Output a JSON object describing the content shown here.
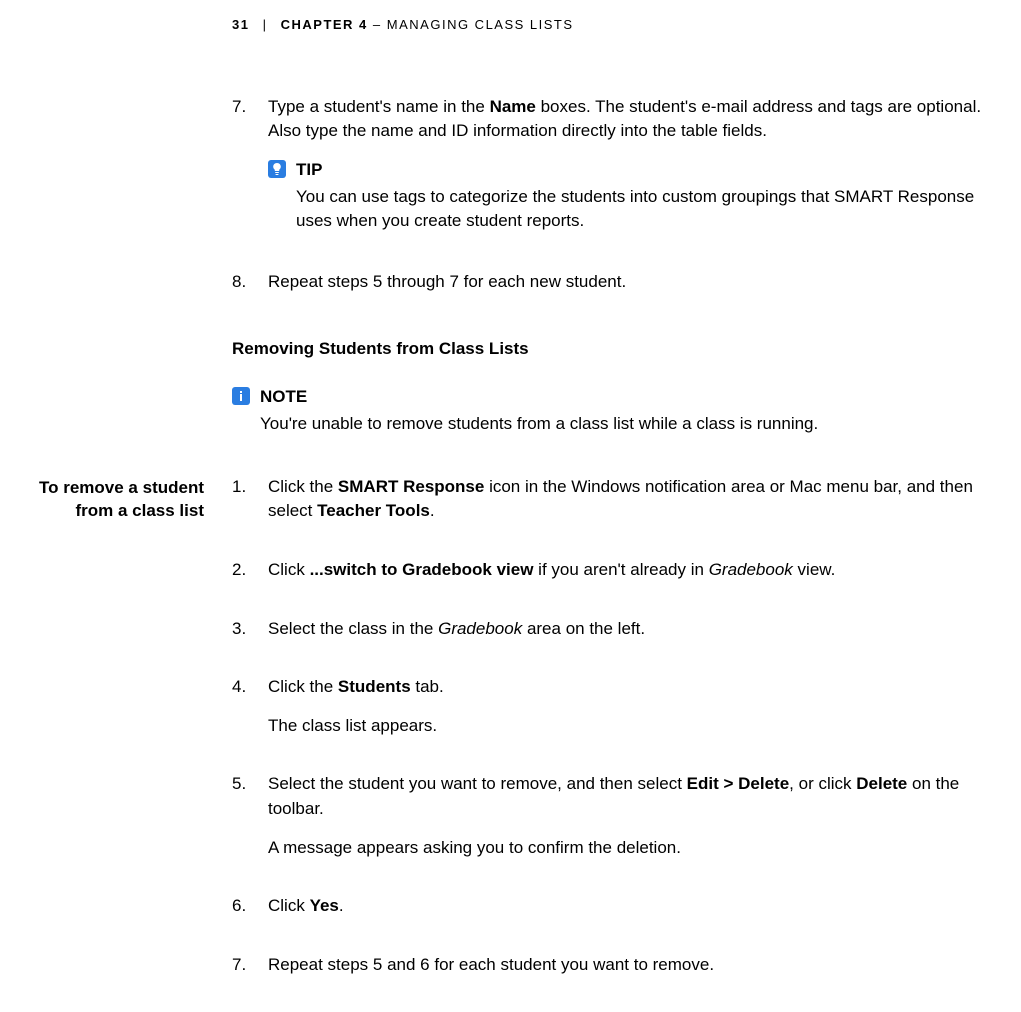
{
  "header": {
    "page": "31",
    "separator": "|",
    "chapter": "CHAPTER 4",
    "dash": "–",
    "title": "MANAGING CLASS LISTS"
  },
  "initialSteps": {
    "step7": {
      "num": "7.",
      "p1_a": "Type a student's name in the ",
      "p1_b": "Name",
      "p1_c": " boxes. The student's e-mail address and tags are optional. Also type the name and ID information directly into the table fields."
    },
    "tip": {
      "title": "TIP",
      "body": "You can use tags to categorize the students into custom groupings that SMART Response uses when you create student reports."
    },
    "step8": {
      "num": "8.",
      "p1": "Repeat steps 5 through 7 for each new student."
    }
  },
  "section": {
    "heading": "Removing Students from Class Lists",
    "note": {
      "title": "NOTE",
      "body": "You're unable to remove students from a class list while a class is running."
    }
  },
  "sidenote": {
    "line1": "To remove a student",
    "line2": "from a class list"
  },
  "removeSteps": {
    "s1": {
      "num": "1.",
      "a": "Click the ",
      "b": "SMART Response",
      "c": " icon in the Windows notification area or Mac menu bar, and then select ",
      "d": "Teacher Tools",
      "e": "."
    },
    "s2": {
      "num": "2.",
      "a": "Click ",
      "b": "...switch to Gradebook view",
      "c": " if you aren't already in ",
      "d": "Gradebook",
      "e": " view."
    },
    "s3": {
      "num": "3.",
      "a": "Select the class in the ",
      "b": "Gradebook",
      "c": " area on the left."
    },
    "s4": {
      "num": "4.",
      "a": "Click the ",
      "b": "Students",
      "c": " tab.",
      "result": "The class list appears."
    },
    "s5": {
      "num": "5.",
      "a": "Select the student you want to remove, and then select ",
      "b": "Edit > Delete",
      "c": ", or click ",
      "d": "Delete",
      "e": " on the toolbar.",
      "result": "A message appears asking you to confirm the deletion."
    },
    "s6": {
      "num": "6.",
      "a": "Click ",
      "b": "Yes",
      "c": "."
    },
    "s7": {
      "num": "7.",
      "a": "Repeat steps 5 and 6 for each student you want to remove."
    }
  }
}
